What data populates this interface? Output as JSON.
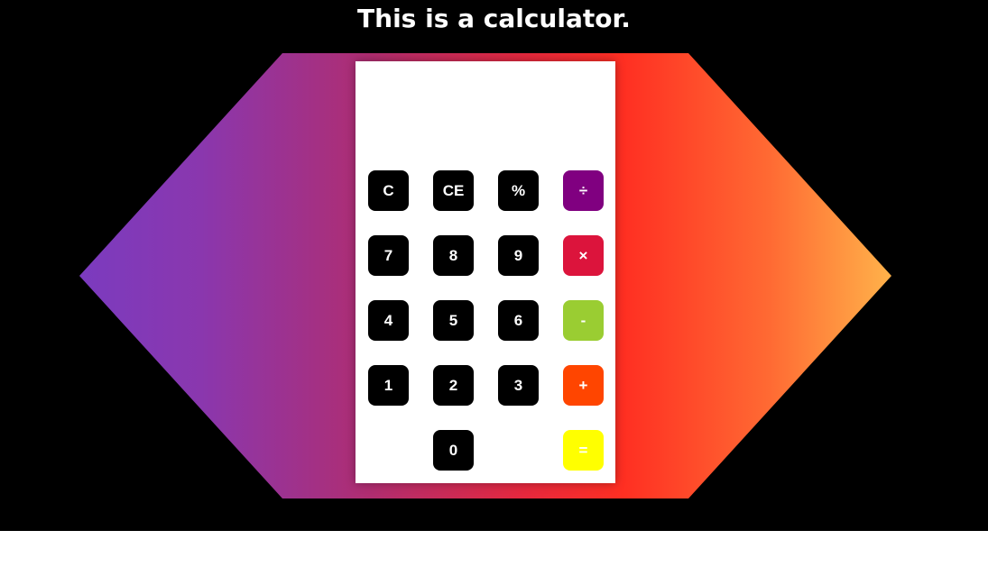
{
  "page": {
    "title": "This is a calculator."
  },
  "calculator": {
    "display_value": "",
    "keys": {
      "clear": "C",
      "clear_entry": "CE",
      "percent": "%",
      "divide": "÷",
      "seven": "7",
      "eight": "8",
      "nine": "9",
      "multiply": "×",
      "four": "4",
      "five": "5",
      "six": "6",
      "subtract": "-",
      "one": "1",
      "two": "2",
      "three": "3",
      "add": "+",
      "zero": "0",
      "equals": "="
    }
  },
  "colors": {
    "background": "#000000",
    "calculator_body": "#ffffff",
    "number_key": "#000000",
    "divide_key": "#800080",
    "multiply_key": "#dc143c",
    "subtract_key": "#9acd32",
    "add_key": "#ff4500",
    "equals_key": "#ffff00",
    "gradient_start": "#7b3bbf",
    "gradient_mid": "#ff2f22",
    "gradient_end": "#ffb24a"
  }
}
